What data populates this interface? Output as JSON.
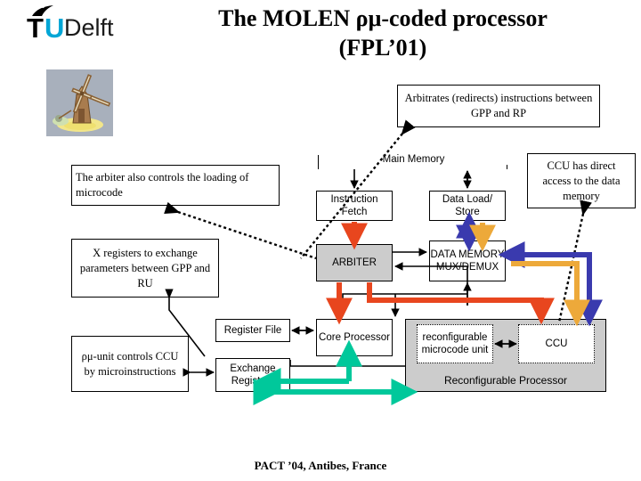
{
  "slide": {
    "title_line1": "The MOLEN ρμ-coded processor",
    "title_line2": "(FPL’01)",
    "footer": "PACT ’04, Antibes, France"
  },
  "logo": {
    "t": "T",
    "u": "U",
    "rest": "Delft",
    "blue": "#00A6D6"
  },
  "callouts": [
    {
      "id": "arbitrates",
      "text": "Arbitrates (redirects) instructions between GPP and RP"
    },
    {
      "id": "arbiter-loads",
      "text": "The arbiter also controls the loading of microcode"
    },
    {
      "id": "ccu-direct",
      "text": "CCU has direct access to the data memory"
    },
    {
      "id": "x-registers",
      "text": "X registers to exchange parameters between GPP and RU"
    },
    {
      "id": "rho-mu-unit",
      "text": "ρμ-unit controls CCU by microinstructions"
    }
  ],
  "diagram": {
    "main_memory": "Main Memory",
    "instruction_fetch": "Instruction Fetch",
    "data_load_store": "Data Load/ Store",
    "arbiter": "ARBITER",
    "data_memory_mux": "DATA MEMORY MUX/DEMUX",
    "register_file": "Register File",
    "core_processor": "Core Processor",
    "exchange_registers": "Exchange Registers",
    "reconfigurable_microcode_unit": "reconfigurable microcode unit",
    "ccu": "CCU",
    "reconfigurable_processor": "Reconfigurable Processor"
  },
  "colors": {
    "arrow_red": "#E8461E",
    "arrow_blue": "#3A3AAE",
    "arrow_orange": "#EDA93A",
    "arrow_teal": "#00C89B",
    "arrow_black": "#000000",
    "box_gray": "#CCCCCC",
    "mill_bg": "#A8B0BC"
  }
}
